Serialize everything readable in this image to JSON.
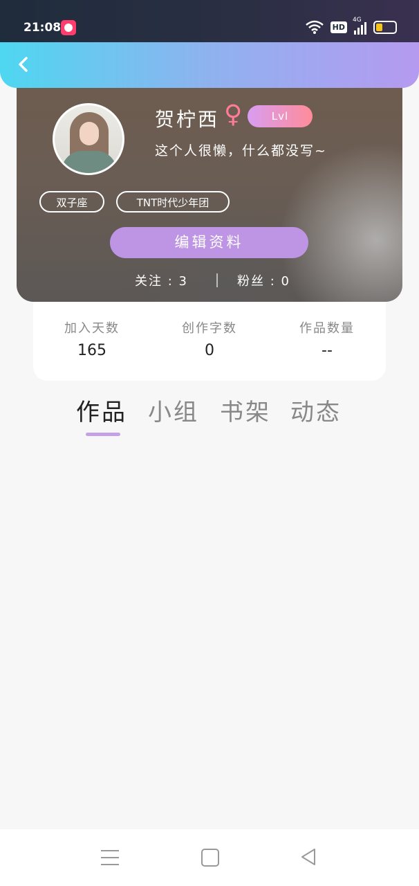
{
  "status_bar": {
    "time": "21:08",
    "hd": "HD",
    "network": "4G"
  },
  "header": {
    "back_icon": "chevron-left-icon"
  },
  "profile": {
    "name": "贺柠西",
    "gender_symbol": "♀",
    "level": "Lvl",
    "bio": "这个人很懒，什么都没写~",
    "tags": [
      "双子座",
      "TNT时代少年团"
    ],
    "edit_label": "编辑资料",
    "follow": "关注 : 3",
    "fans": "粉丝 : 0"
  },
  "stats": [
    {
      "label": "加入天数",
      "value": "165"
    },
    {
      "label": "创作字数",
      "value": "0"
    },
    {
      "label": "作品数量",
      "value": "--"
    }
  ],
  "tabs": [
    {
      "label": "作品",
      "active": true
    },
    {
      "label": "小组",
      "active": false
    },
    {
      "label": "书架",
      "active": false
    },
    {
      "label": "动态",
      "active": false
    }
  ],
  "colors": {
    "accent": "#be94e4",
    "header_gradient_start": "#4ed7f1",
    "header_gradient_end": "#b59af0",
    "level_badge": "#ff8c9a"
  },
  "nav": {
    "menu_icon": "menu-icon",
    "home_icon": "home-square-icon",
    "back_icon": "triangle-back-icon"
  }
}
